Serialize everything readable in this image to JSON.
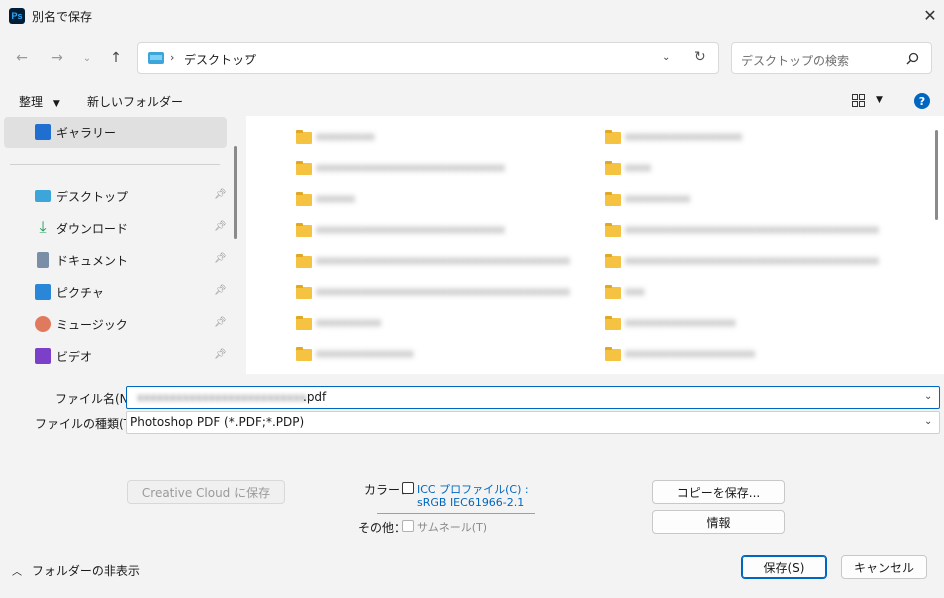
{
  "window": {
    "title": "別名で保存",
    "app_icon_text": "Ps"
  },
  "nav": {
    "breadcrumb": [
      "デスクトップ"
    ],
    "search_placeholder": "デスクトップの検索"
  },
  "toolbar": {
    "organize": "整理",
    "new_folder": "新しいフォルダー"
  },
  "sidebar": {
    "items": [
      {
        "label": "ギャラリー",
        "icon": "gallery-icon",
        "pinned": false
      },
      {
        "label": "デスクトップ",
        "icon": "desktop-icon",
        "pinned": true
      },
      {
        "label": "ダウンロード",
        "icon": "download-icon",
        "pinned": true
      },
      {
        "label": "ドキュメント",
        "icon": "document-icon",
        "pinned": true
      },
      {
        "label": "ピクチャ",
        "icon": "pictures-icon",
        "pinned": true
      },
      {
        "label": "ミュージック",
        "icon": "music-icon",
        "pinned": true
      },
      {
        "label": "ビデオ",
        "icon": "video-icon",
        "pinned": true
      }
    ]
  },
  "files": {
    "left_column": [
      "xxxxxxxxx",
      "xxxxxxxxxxxxxxxxxxxxxxxxxxxxx",
      "xxxxxx",
      "xxxxxxxxxxxxxxxxxxxxxxxxxxxxx",
      "xxxxxxxxxxxxxxxxxxxxxxxxxxxxxxxxxxxxxxx",
      "xxxxxxxxxxxxxxxxxxxxxxxxxxxxxxxxxxxxxxx",
      "xxxxxxxxxx",
      "xxxxxxxxxxxxxxx"
    ],
    "right_column": [
      "xxxxxxxxxxxxxxxxxx",
      "xxxx",
      "xxxxxxxxxx",
      "xxxxxxxxxxxxxxxxxxxxxxxxxxxxxxxxxxxxxxx",
      "xxxxxxxxxxxxxxxxxxxxxxxxxxxxxxxxxxxxxxx",
      "xxx",
      "xxxxxxxxxxxxxxxxx",
      "xxxxxxxxxxxxxxxxxxxx"
    ]
  },
  "form": {
    "filename_label": "ファイル名(N):",
    "filename_blurred": "xxxxxxxxxxxxxxxxxxxxxxxxxx",
    "filename_ext": ".pdf",
    "filetype_label": "ファイルの種類(T):",
    "filetype_value": "Photoshop PDF (*.PDF;*.PDP)",
    "cc_save": "Creative Cloud に保存",
    "color_label": "カラー：",
    "icc_label": "ICC プロファイル(C) :",
    "icc_value": "sRGB IEC61966-2.1",
    "other_label": "その他：",
    "thumbnail_label": "サムネール(T)",
    "copy_save": "コピーを保存...",
    "info": "情報",
    "hide_folders": "フォルダーの非表示",
    "save": "保存(S)",
    "cancel": "キャンセル"
  }
}
